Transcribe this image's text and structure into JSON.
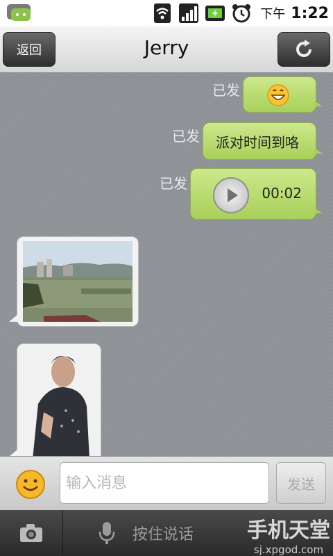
{
  "status_bar": {
    "time_prefix": "下午",
    "time": "1:22"
  },
  "header": {
    "back_label": "返回",
    "title": "Jerry"
  },
  "messages": [
    {
      "type": "emoji",
      "direction": "out",
      "status": "已发"
    },
    {
      "type": "text",
      "direction": "out",
      "status": "已发",
      "text": "派对时间到咯"
    },
    {
      "type": "voice",
      "direction": "out",
      "status": "已发",
      "duration": "00:02"
    },
    {
      "type": "image",
      "direction": "in",
      "content": "lake photo"
    },
    {
      "type": "image",
      "direction": "in",
      "content": "portrait photo"
    }
  ],
  "input": {
    "placeholder": "输入消息",
    "send_label": "发送"
  },
  "bottom_bar": {
    "voice_label": "按住说话"
  },
  "watermark": {
    "main": "手机天堂",
    "sub": "sj.xpgod.com"
  },
  "colors": {
    "bubble_out": "#b8dc6c",
    "chat_bg": "#8f9397",
    "bottom_bar": "#333333"
  }
}
